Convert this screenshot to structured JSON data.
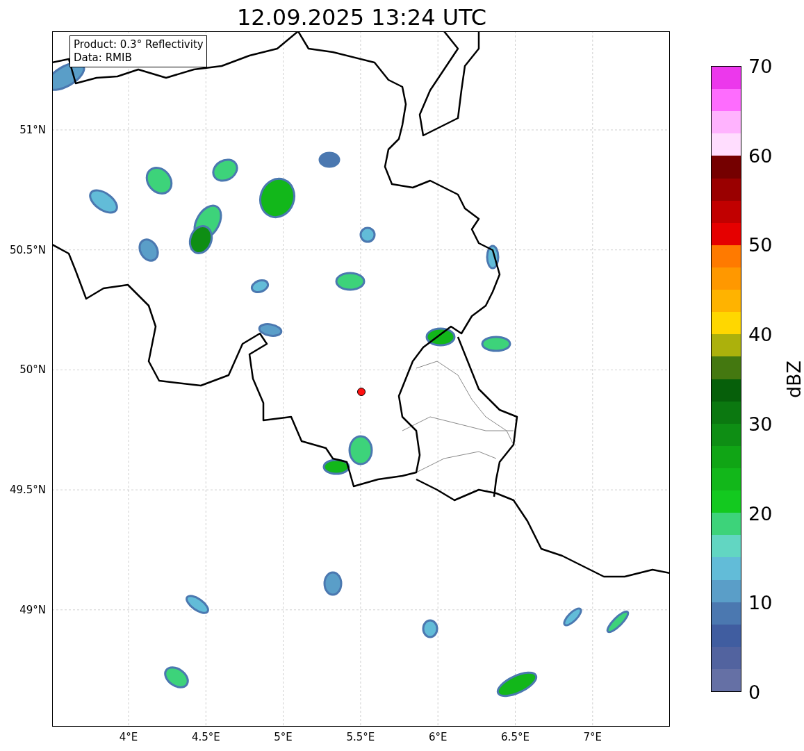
{
  "title": "12.09.2025 13:24 UTC",
  "info_box": {
    "lines": [
      "Product: 0.3° Reflectivity",
      "Data: RMIB"
    ]
  },
  "x_ticks": [
    "4°E",
    "4.5°E",
    "5°E",
    "5.5°E",
    "6°E",
    "6.5°E",
    "7°E"
  ],
  "y_ticks": [
    "51°N",
    "50.5°N",
    "50°N",
    "49.5°N",
    "49°N"
  ],
  "colorbar": {
    "label": "dBZ",
    "ticks": [
      "70",
      "60",
      "50",
      "40",
      "30",
      "20",
      "10",
      "0"
    ],
    "steps": [
      {
        "color": "#ec38ec"
      },
      {
        "color": "#fe6cfe"
      },
      {
        "color": "#ffb3fe"
      },
      {
        "color": "#ffddfe"
      },
      {
        "color": "#750000"
      },
      {
        "color": "#9a0000"
      },
      {
        "color": "#c10000"
      },
      {
        "color": "#e50000"
      },
      {
        "color": "#ff7a00"
      },
      {
        "color": "#ff9800"
      },
      {
        "color": "#ffb300"
      },
      {
        "color": "#ffd700"
      },
      {
        "color": "#acb10c"
      },
      {
        "color": "#447810"
      },
      {
        "color": "#065f0a"
      },
      {
        "color": "#0b7810"
      },
      {
        "color": "#0e8e14"
      },
      {
        "color": "#10a515"
      },
      {
        "color": "#12b71a"
      },
      {
        "color": "#13c91f"
      },
      {
        "color": "#3dd37a"
      },
      {
        "color": "#62d6c2"
      },
      {
        "color": "#62bcd8"
      },
      {
        "color": "#5a9ec8"
      },
      {
        "color": "#4b78b0"
      },
      {
        "color": "#405da0"
      },
      {
        "color": "#52639f"
      },
      {
        "color": "#6570a5"
      }
    ]
  }
}
